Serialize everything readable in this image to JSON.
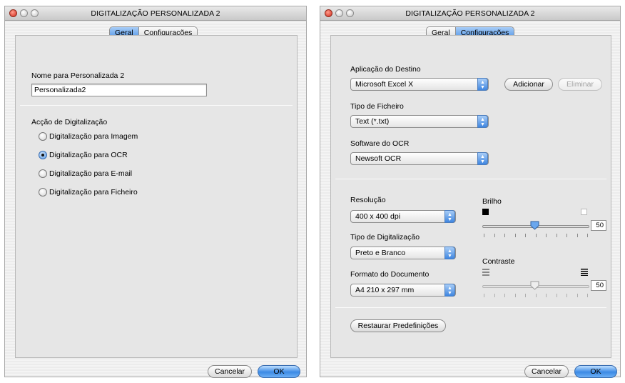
{
  "left_window": {
    "title": "DIGITALIZAÇÃO PERSONALIZADA 2",
    "tabs": [
      "Geral",
      "Configurações"
    ],
    "active_tab": "Geral",
    "name_label": "Nome para Personalizada 2",
    "name_value": "Personalizada2",
    "action_label": "Acção de Digitalização",
    "actions": [
      {
        "label": "Digitalização para Imagem",
        "checked": false
      },
      {
        "label": "Digitalização para OCR",
        "checked": true
      },
      {
        "label": "Digitalização para E-mail",
        "checked": false
      },
      {
        "label": "Digitalização para Ficheiro",
        "checked": false
      }
    ],
    "cancel_label": "Cancelar",
    "ok_label": "OK"
  },
  "right_window": {
    "title": "DIGITALIZAÇÃO PERSONALIZADA 2",
    "tabs": [
      "Geral",
      "Configurações"
    ],
    "active_tab": "Configurações",
    "dest_app_label": "Aplicação do Destino",
    "dest_app_value": "Microsoft Excel X",
    "add_label": "Adicionar",
    "delete_label": "Eliminar",
    "file_type_label": "Tipo de Ficheiro",
    "file_type_value": "Text (*.txt)",
    "ocr_label": "Software do OCR",
    "ocr_value": "Newsoft OCR",
    "resolution_label": "Resolução",
    "resolution_value": "400 x 400 dpi",
    "scan_type_label": "Tipo de Digitalização",
    "scan_type_value": "Preto e Branco",
    "doc_format_label": "Formato do Documento",
    "doc_format_value": "A4 210 x 297 mm",
    "brightness_label": "Brilho",
    "brightness_value": "50",
    "contrast_label": "Contraste",
    "contrast_value": "50",
    "brightness_enabled": true,
    "contrast_enabled": false,
    "restore_label": "Restaurar Predefinições",
    "cancel_label": "Cancelar",
    "ok_label": "OK"
  },
  "colors": {
    "accent": "#4f93e6",
    "disabled_text": "#a0a0a0"
  },
  "icons": {
    "popup_arrows": "up-down-arrows",
    "brightness_low": "black-square",
    "brightness_high": "white-square",
    "contrast_low": "low-contrast-lines",
    "contrast_high": "high-contrast-lines"
  }
}
